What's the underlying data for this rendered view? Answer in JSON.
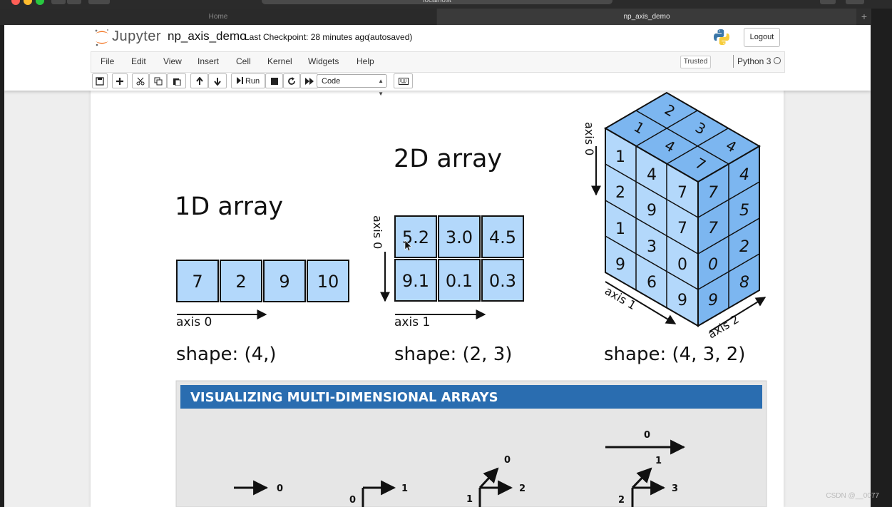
{
  "browser": {
    "address": "localhost",
    "tabs": [
      "Home",
      "np_axis_demo"
    ],
    "new_tab": "+"
  },
  "header": {
    "logo_text": "Jupyter",
    "notebook_name": "np_axis_demo",
    "checkpoint": "Last Checkpoint: 28 minutes ago",
    "autosave": "(autosaved)",
    "logout": "Logout"
  },
  "menu": {
    "items": [
      "File",
      "Edit",
      "View",
      "Insert",
      "Cell",
      "Kernel",
      "Widgets",
      "Help"
    ],
    "trusted": "Trusted",
    "kernel": "Python 3"
  },
  "toolbar": {
    "run_label": "Run",
    "cell_type": "Code"
  },
  "figure": {
    "oned": {
      "title": "1D array",
      "values": [
        "7",
        "2",
        "9",
        "10"
      ],
      "axis0": "axis 0",
      "shape": "shape: (4,)"
    },
    "twod": {
      "title": "2D array",
      "values": [
        [
          "5.2",
          "3.0",
          "4.5"
        ],
        [
          "9.1",
          "0.1",
          "0.3"
        ]
      ],
      "axis0": "axis 0",
      "axis1": "axis 1",
      "shape": "shape: (2, 3)"
    },
    "threed": {
      "top": [
        "1",
        "2",
        "4",
        "3",
        "7",
        "4"
      ],
      "front_left": [
        "1",
        "4",
        "2",
        "9",
        "1",
        "3",
        "9",
        "6"
      ],
      "front_right": [
        "7",
        "7",
        "9",
        "7",
        "7",
        "7",
        "0",
        "0",
        "9",
        "9"
      ],
      "side": [
        "4",
        "5",
        "2",
        "8"
      ],
      "axis0": "axis 0",
      "axis1": "axis 1",
      "axis2": "axis 2",
      "shape": "shape: (4, 3, 2)"
    },
    "banner": {
      "title": "VISUALIZING MULTI-DIMENSIONAL ARRAYS",
      "labels": [
        "0",
        "0",
        "1",
        "0",
        "1",
        "2",
        "0",
        "1",
        "2",
        "3"
      ]
    }
  },
  "watermark": "CSDN @__0077"
}
